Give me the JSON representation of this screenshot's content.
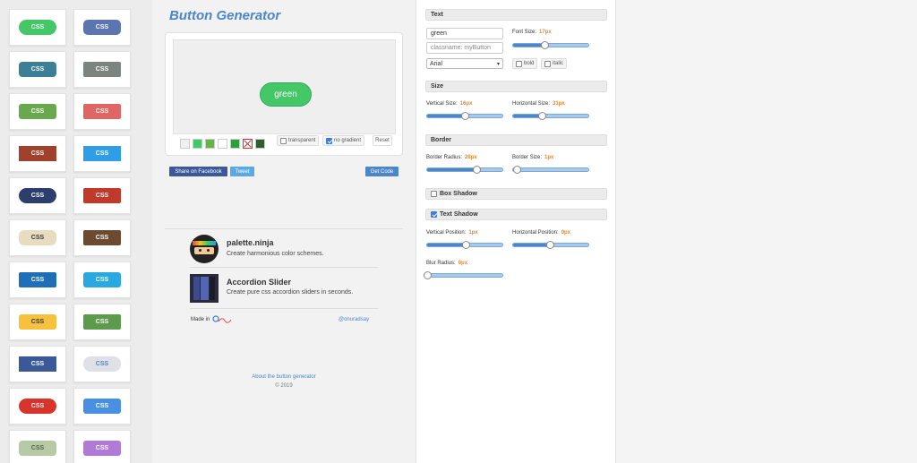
{
  "app": {
    "title": "Button Generator"
  },
  "sidebar": {
    "tiles": [
      {
        "label": "CSS",
        "bg": "#44c767",
        "fg": "#ffffff",
        "radius": "9px"
      },
      {
        "label": "CSS",
        "bg": "#5b75b0",
        "fg": "#ffffff",
        "radius": "5px"
      },
      {
        "label": "CSS",
        "bg": "#3d7f96",
        "fg": "#ffffff",
        "radius": "4px"
      },
      {
        "label": "CSS",
        "bg": "#7b847f",
        "fg": "#ffffff",
        "radius": "2px"
      },
      {
        "label": "CSS",
        "bg": "#6aa84f",
        "fg": "#ffffff",
        "radius": "3px"
      },
      {
        "label": "CSS",
        "bg": "#e06666",
        "fg": "#ffffff",
        "radius": "2px"
      },
      {
        "label": "CSS",
        "bg": "#a0412d",
        "fg": "#ffffff",
        "radius": "0px"
      },
      {
        "label": "CSS",
        "bg": "#2f9de8",
        "fg": "#ffffff",
        "radius": "0px"
      },
      {
        "label": "CSS",
        "bg": "#2c3e6b",
        "fg": "#ffffff",
        "radius": "9px"
      },
      {
        "label": "CSS",
        "bg": "#c0392b",
        "fg": "#ffffff",
        "radius": "2px"
      },
      {
        "label": "CSS",
        "bg": "#e8dcc0",
        "fg": "#333333",
        "radius": "6px"
      },
      {
        "label": "CSS",
        "bg": "#6b4a2f",
        "fg": "#ffffff",
        "radius": "2px"
      },
      {
        "label": "CSS",
        "bg": "#1e6fb8",
        "fg": "#ffffff",
        "radius": "2px"
      },
      {
        "label": "CSS",
        "bg": "#2aa9e0",
        "fg": "#ffffff",
        "radius": "3px"
      },
      {
        "label": "CSS",
        "bg": "#f6c23e",
        "fg": "#333333",
        "radius": "3px"
      },
      {
        "label": "CSS",
        "bg": "#5e9a4c",
        "fg": "#ffffff",
        "radius": "2px"
      },
      {
        "label": "CSS",
        "bg": "#3b5998",
        "fg": "#ffffff",
        "radius": "0px"
      },
      {
        "label": "CSS",
        "bg": "#e0e0e8",
        "fg": "#4a86c8",
        "radius": "8px"
      },
      {
        "label": "CSS",
        "bg": "#d9342b",
        "fg": "#ffffff",
        "radius": "9px"
      },
      {
        "label": "CSS",
        "bg": "#4a90e2",
        "fg": "#ffffff",
        "radius": "3px"
      },
      {
        "label": "CSS",
        "bg": "#b8c9a8",
        "fg": "#4a6a3a",
        "radius": "4px"
      },
      {
        "label": "CSS",
        "bg": "#b07ad8",
        "fg": "#ffffff",
        "radius": "3px"
      }
    ]
  },
  "preview": {
    "button_text": "green",
    "button_bg": "#44c767",
    "swatches": [
      "#f0f0f0",
      "#44c767",
      "#6ab04c",
      "#ffffff",
      "#2e9e3e",
      "x",
      "#2f5d2f"
    ],
    "transparent_label": "transparent",
    "transparent_checked": false,
    "no_gradient_label": "no gradient",
    "no_gradient_checked": true,
    "reset_label": "Reset"
  },
  "actions": {
    "facebook_label": "Share on Facebook",
    "tweet_label": "Tweet",
    "get_code_label": "Get Code"
  },
  "promos": [
    {
      "title": "palette.ninja",
      "desc": "Create harmonious color schemes."
    },
    {
      "title": "Accordion Slider",
      "desc": "Create pure css accordion sliders in seconds."
    }
  ],
  "footer": {
    "made_in": "Made in",
    "twitter": "@onuradsay",
    "about": "About the button generator",
    "copyright": "© 2019"
  },
  "panel": {
    "text": {
      "header": "Text",
      "text_value": "green",
      "classname_placeholder": "classname: myButton",
      "font_family": "Arial",
      "font_size_label": "Font Size:",
      "font_size_value": "17px",
      "font_size_fraction": 0.42,
      "bold_label": "bold",
      "italic_label": "italic"
    },
    "size": {
      "header": "Size",
      "vertical_label": "Vertical Size:",
      "vertical_value": "16px",
      "vertical_fraction": 0.5,
      "horizontal_label": "Horizontal Size:",
      "horizontal_value": "31px",
      "horizontal_fraction": 0.38
    },
    "border": {
      "header": "Border",
      "radius_label": "Border Radius:",
      "radius_value": "28px",
      "radius_fraction": 0.66,
      "size_label": "Border Size:",
      "size_value": "1px",
      "size_fraction": 0.05
    },
    "box_shadow": {
      "header": "Box Shadow",
      "checked": false
    },
    "text_shadow": {
      "header": "Text Shadow",
      "checked": true,
      "vertical_label": "Vertical Position:",
      "vertical_value": "1px",
      "vertical_fraction": 0.51,
      "horizontal_label": "Horizontal Position:",
      "horizontal_value": "0px",
      "horizontal_fraction": 0.49,
      "blur_label": "Blur Radius:",
      "blur_value": "0px",
      "blur_fraction": 0.0
    }
  }
}
